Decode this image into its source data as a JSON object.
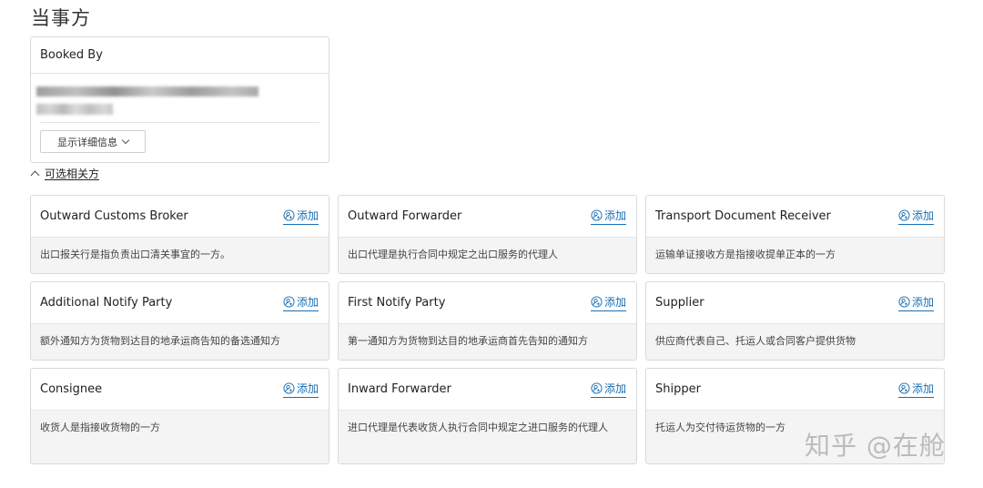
{
  "page_title": "当事方",
  "booked_by": {
    "title": "Booked By",
    "show_details_label": "显示详细信息"
  },
  "optional_parties_label": "可选相关方",
  "add_label": "添加",
  "parties": [
    {
      "title": "Outward Customs Broker",
      "description": "出口报关行是指负责出口清关事宜的一方。"
    },
    {
      "title": "Outward Forwarder",
      "description": "出口代理是执行合同中规定之出口服务的代理人"
    },
    {
      "title": "Transport Document Receiver",
      "description": "运输单证接收方是指接收提单正本的一方"
    },
    {
      "title": "Additional Notify Party",
      "description": "额外通知方为货物到达目的地承运商告知的备选通知方"
    },
    {
      "title": "First Notify Party",
      "description": "第一通知方为货物到达目的地承运商首先告知的通知方"
    },
    {
      "title": "Supplier",
      "description": "供应商代表自己、托运人或合同客户提供货物"
    },
    {
      "title": "Consignee",
      "description": "收货人是指接收货物的一方"
    },
    {
      "title": "Inward Forwarder",
      "description": "进口代理是代表收货人执行合同中规定之进口服务的代理人"
    },
    {
      "title": "Shipper",
      "description": "托运人为交付待运货物的一方"
    }
  ],
  "icons": {
    "add": "person-add-icon",
    "details_chevron": "chevron-down-icon",
    "collapse_chevron": "chevron-up-icon"
  },
  "colors": {
    "link": "#1a6fb3",
    "card_border": "#d9d9d9",
    "card_body_bg": "#f4f4f4"
  },
  "watermark": "知乎 @在舱"
}
